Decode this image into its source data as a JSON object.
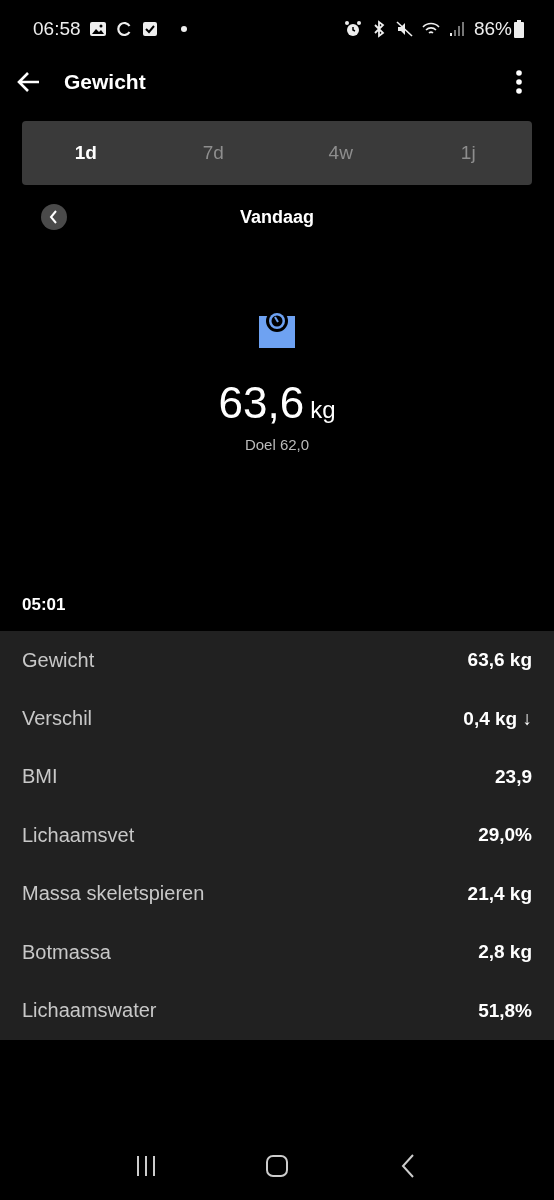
{
  "status_bar": {
    "time": "06:58",
    "battery": "86%"
  },
  "app_bar": {
    "title": "Gewicht"
  },
  "tabs": [
    {
      "label": "1d",
      "selected": true
    },
    {
      "label": "7d",
      "selected": false
    },
    {
      "label": "4w",
      "selected": false
    },
    {
      "label": "1j",
      "selected": false
    }
  ],
  "period": {
    "label": "Vandaag"
  },
  "summary": {
    "value": "63,6",
    "unit": "kg",
    "goal": "Doel 62,0"
  },
  "measurement_time": "05:01",
  "rows": [
    {
      "label": "Gewicht",
      "value": "63,6 kg"
    },
    {
      "label": "Verschil",
      "value": "0,4 kg ↓"
    },
    {
      "label": "BMI",
      "value": "23,9"
    },
    {
      "label": "Lichaamsvet",
      "value": "29,0%"
    },
    {
      "label": "Massa skeletspieren",
      "value": "21,4 kg"
    },
    {
      "label": "Botmassa",
      "value": "2,8 kg"
    },
    {
      "label": "Lichaamswater",
      "value": "51,8%"
    }
  ]
}
